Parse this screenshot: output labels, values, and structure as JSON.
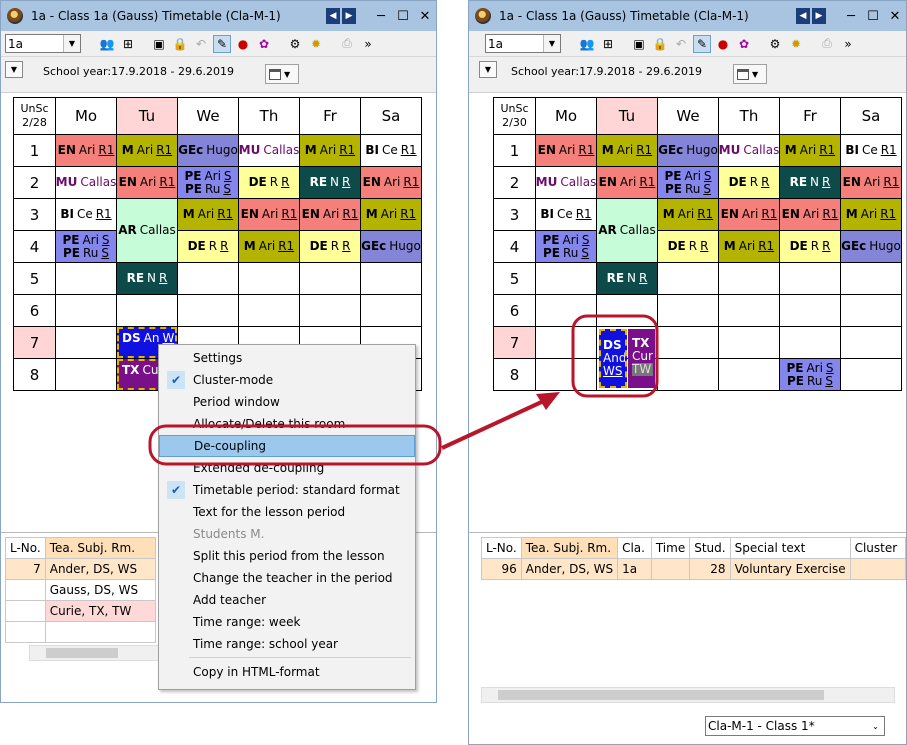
{
  "win1": {
    "title": "1a - Class 1a (Gauss)  Timetable  (Cla-M-1)",
    "class_value": "1a",
    "school_year": "School year:17.9.2018 - 29.6.2019",
    "unsc": [
      "UnSc",
      "2/28"
    ]
  },
  "win2": {
    "title": "1a - Class 1a (Gauss)  Timetable  (Cla-M-1)",
    "class_value": "1a",
    "school_year": "School year:17.9.2018 - 29.6.2019",
    "unsc": [
      "UnSc",
      "2/30"
    ],
    "view_select": "Cla-M-1 - Class 1*"
  },
  "days": [
    "Mo",
    "Tu",
    "We",
    "Th",
    "Fr",
    "Sa"
  ],
  "periods": [
    "1",
    "2",
    "3",
    "4",
    "5",
    "6",
    "7",
    "8"
  ],
  "colors": {
    "EN": "#f57f7b",
    "M": "#b4b400",
    "GEc": "#8585d8",
    "MU": "#ffffff",
    "BI": "#ffffff",
    "PE": "#8585ee",
    "DE": "#ffff99",
    "RE": "#0d4b4b",
    "AR": "#c6fcd8",
    "DS": "#1010e0",
    "TX": "#7a0f8a",
    "tu_header": "#ffd5d5",
    "p7_header": "#ffd5d5",
    "highlight_red": "#b8162a"
  },
  "cells": {
    "mo1": {
      "s": "EN",
      "t": "Ari",
      "r": "R1"
    },
    "tu1": {
      "s": "M",
      "t": "Ari",
      "r": "R1"
    },
    "we1": {
      "s": "GEc",
      "t": "Hugo"
    },
    "th1": {
      "s": "MU",
      "t": "Callas"
    },
    "fr1": {
      "s": "M",
      "t": "Ari",
      "r": "R1"
    },
    "sa1": {
      "s": "BI",
      "t": "Ce",
      "r": "R1"
    },
    "mo2": {
      "s": "MU",
      "t": "Callas"
    },
    "tu2": {
      "s": "EN",
      "t": "Ari",
      "r": "R1"
    },
    "we2a": {
      "s": "PE",
      "t": "Ari",
      "r": "S"
    },
    "we2b": {
      "s": "PE",
      "t": "Ru",
      "r": "S"
    },
    "th2": {
      "s": "DE",
      "t": "R",
      "r": "R"
    },
    "fr2": {
      "s": "RE",
      "t": "N",
      "r": "R"
    },
    "sa2": {
      "s": "EN",
      "t": "Ari",
      "r": "R1"
    },
    "mo3": {
      "s": "BI",
      "t": "Ce",
      "r": "R1"
    },
    "tu34": {
      "s": "AR",
      "t": "Callas"
    },
    "we3": {
      "s": "M",
      "t": "Ari",
      "r": "R1"
    },
    "th3": {
      "s": "EN",
      "t": "Ari",
      "r": "R1"
    },
    "fr3": {
      "s": "EN",
      "t": "Ari",
      "r": "R1"
    },
    "sa3": {
      "s": "M",
      "t": "Ari",
      "r": "R1"
    },
    "mo4a": {
      "s": "PE",
      "t": "Ari",
      "r": "S"
    },
    "mo4b": {
      "s": "PE",
      "t": "Ru",
      "r": "S"
    },
    "we4": {
      "s": "DE",
      "t": "R",
      "r": "R"
    },
    "th4": {
      "s": "M",
      "t": "Ari",
      "r": "R1"
    },
    "fr4": {
      "s": "DE",
      "t": "R",
      "r": "R"
    },
    "sa4": {
      "s": "GEc",
      "t": "Hugo"
    },
    "tu5": {
      "s": "RE",
      "t": "N",
      "r": "R"
    },
    "w1_ds": {
      "s": "DS",
      "t": "An",
      "r": "W"
    },
    "w1_tx": {
      "s": "TX",
      "t": "Cu"
    },
    "w2_ds": {
      "s": "DS",
      "t": "And",
      "r": "WS"
    },
    "w2_tx": {
      "s": "TX",
      "t": "Cur",
      "r": "TW"
    },
    "fr8a": {
      "s": "PE",
      "t": "Ari",
      "r": "S"
    },
    "fr8b": {
      "s": "PE",
      "t": "Ru",
      "r": "S"
    }
  },
  "lessons1": {
    "header": [
      "L-No.",
      "Tea. Subj. Rm."
    ],
    "rows": [
      [
        "7",
        "Ander, DS, WS"
      ],
      [
        "",
        "Gauss, DS, WS"
      ],
      [
        "",
        "Curie, TX, TW"
      ],
      [
        "",
        ""
      ]
    ]
  },
  "lessons2": {
    "header": [
      "L-No.",
      "Tea. Subj. Rm.",
      "Cla.",
      "Time",
      "Stud.",
      "Special text",
      "Cluster"
    ],
    "rows": [
      [
        "96",
        "Ander, DS, WS",
        "1a",
        "",
        "28",
        "Voluntary Exercise",
        ""
      ]
    ]
  },
  "menu": [
    "Settings",
    "Cluster-mode",
    "Period window",
    "Allocate/Delete this room",
    "De-coupling",
    "Extended de-coupling",
    "Timetable period: standard format",
    "Text for the lesson period",
    "Students M.",
    "Split this period from the lesson",
    "Change the teacher in the period",
    "Add teacher",
    "Time range: week",
    "Time range: school year",
    "Copy in HTML-format"
  ]
}
